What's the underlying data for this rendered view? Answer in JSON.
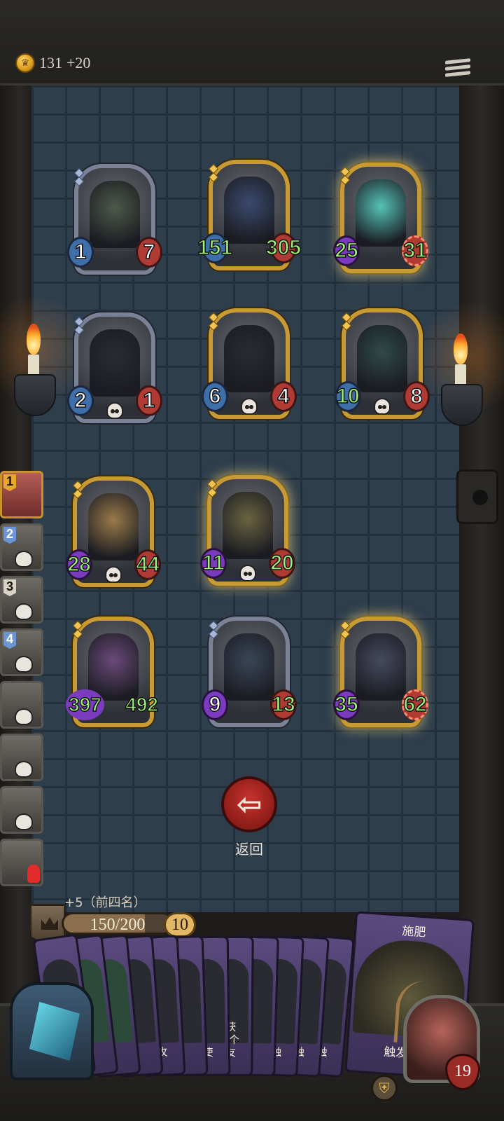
{
  "topbar": {
    "gold": "131",
    "gold_gain": "+20",
    "coin_icon": "crown-coin-icon",
    "menu_icon": "menu-icon"
  },
  "board": {
    "units": [
      {
        "id": "u1",
        "atk": "1",
        "hp": "7",
        "frame": "silver",
        "portrait_color": "#4d5a4a",
        "skull": false
      },
      {
        "id": "u2",
        "atk": "151",
        "hp": "305",
        "frame": "gold",
        "portrait_color": "#3b4a6e",
        "skull": false
      },
      {
        "id": "u3",
        "atk": "25",
        "hp": "31",
        "frame": "gold-glow",
        "portrait_color": "#55c3b8",
        "skull": false
      },
      {
        "id": "u4",
        "atk": "2",
        "hp": "1",
        "frame": "silver",
        "portrait_color": "#2a2a33",
        "skull": true
      },
      {
        "id": "u5",
        "atk": "6",
        "hp": "4",
        "frame": "gold",
        "portrait_color": "#2a2a33",
        "skull": true
      },
      {
        "id": "u6",
        "atk": "10",
        "hp": "8",
        "frame": "gold",
        "portrait_color": "#2f4a48",
        "skull": true
      },
      {
        "id": "u7",
        "atk": "28",
        "hp": "44",
        "frame": "gold",
        "portrait_color": "#9b7a4a",
        "skull": true
      },
      {
        "id": "u8",
        "atk": "11",
        "hp": "20",
        "frame": "gold-glow",
        "portrait_color": "#6a6440",
        "skull": true
      },
      {
        "id": "u9",
        "atk": "397",
        "hp": "492",
        "frame": "gold",
        "portrait_color": "#6b4a7a",
        "skull": false
      },
      {
        "id": "u10",
        "atk": "9",
        "hp": "13",
        "frame": "silver",
        "portrait_color": "#3a4658",
        "skull": false
      },
      {
        "id": "u11",
        "atk": "35",
        "hp": "62",
        "frame": "gold-glow",
        "portrait_color": "#454a5e",
        "skull": false
      }
    ]
  },
  "ranking": [
    {
      "rank": "1",
      "state": "active"
    },
    {
      "rank": "2",
      "state": "dead"
    },
    {
      "rank": "3",
      "state": "dead"
    },
    {
      "rank": "4",
      "state": "dead"
    },
    {
      "rank": "",
      "state": "dead"
    },
    {
      "rank": "",
      "state": "dead"
    },
    {
      "rank": "",
      "state": "dead"
    },
    {
      "rank": "",
      "state": "fleeing"
    }
  ],
  "back": {
    "label": "返回",
    "icon": "arrow-left-icon"
  },
  "player": {
    "bonus_text": "+5（前四名）",
    "xp_current": 150,
    "xp_max": 200,
    "xp_text": "150/200",
    "level": "10",
    "hero_hp": "19",
    "level_icon": "crown-icon",
    "ability_icon": "shield-icon"
  },
  "hand": {
    "small_cards": [
      {
        "text": ""
      },
      {
        "text": ""
      },
      {
        "text": ""
      },
      {
        "text": ""
      },
      {
        "text": "攻"
      },
      {
        "text": ""
      },
      {
        "text": "使"
      },
      {
        "text": "获\n1个\n友"
      },
      {
        "text": ""
      },
      {
        "text": "触"
      },
      {
        "text": "触"
      },
      {
        "text": "触"
      }
    ],
    "featured": {
      "title": "施肥",
      "text": "触发1个"
    }
  },
  "deck": {
    "icon": "crystal-deck-icon"
  }
}
